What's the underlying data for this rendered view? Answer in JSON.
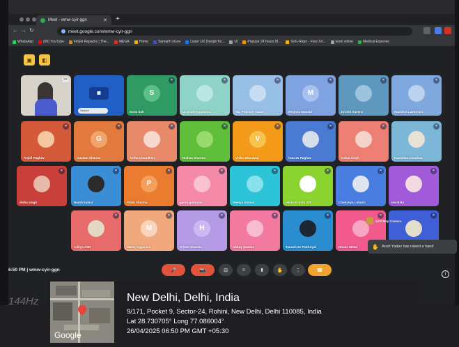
{
  "browser": {
    "tab_title": "Meet - wmw-cyir-ggn",
    "url": "meet.google.com/wmw-cyir-ggn",
    "bookmarks": [
      "WhatsApp",
      "(89) YouTube",
      "FitGirl Repacks | The...",
      "MEGA",
      "Home",
      "Samarth eGov",
      "Learn UX Design for...",
      "UI",
      "Popular 24 hours M...",
      "SVG Repo - Free SV...",
      "work online",
      "Medical Expense"
    ]
  },
  "meet": {
    "meeting_info": "6:50 PM  |  wmw-cyir-ggn",
    "raised_hand_toast": "Ansh Yadav has raised a hand",
    "self_tile_search": "Search",
    "participants": [
      {
        "name": "",
        "initial": "",
        "color": "#d7d3cb",
        "avatar_color": "#3a3534"
      },
      {
        "name": "",
        "initial": "",
        "color": "#1f5fc6",
        "avatar_color": "#1f5fc6"
      },
      {
        "name": "Sonu Sah",
        "initial": "S",
        "color": "#2f9a63",
        "avatar_color": "#5cbf8a"
      },
      {
        "name": "Dr.Southeggulattar...",
        "initial": "",
        "color": "#8fd3c8",
        "avatar_color": "#b9e6e0"
      },
      {
        "name": "Ms. Poonam Yadav",
        "initial": "",
        "color": "#98bfe6",
        "avatar_color": "#c8dcf2"
      },
      {
        "name": "Meghna Mandal",
        "initial": "M",
        "color": "#7fa3e0",
        "avatar_color": "#a9c1ee"
      },
      {
        "name": "Drishti Saxena",
        "initial": "",
        "color": "#5f98bf",
        "avatar_color": "#9dc3dd"
      },
      {
        "name": "Nachiket Lakhmani",
        "initial": "",
        "color": "#7fa8de",
        "avatar_color": "#bcd2ef"
      },
      {
        "name": "Anjali Raghav",
        "initial": "",
        "color": "#d55a3a",
        "avatar_color": "#f4c7a1"
      },
      {
        "name": "Gautam Sharma",
        "initial": "G",
        "color": "#e27a3e",
        "avatar_color": "#f1a46e"
      },
      {
        "name": "Astha Choudhary",
        "initial": "",
        "color": "#e88a6a",
        "avatar_color": "#f7d8cf"
      },
      {
        "name": "Bishan Sharma",
        "initial": "",
        "color": "#5fbf3a",
        "avatar_color": "#9ad96e"
      },
      {
        "name": "Vishu Bhardwaj",
        "initial": "V",
        "color": "#f39a1a",
        "avatar_color": "#f7c24e"
      },
      {
        "name": "Gaurav Raghav",
        "initial": "",
        "color": "#4a7ad2",
        "avatar_color": "#d7dee9"
      },
      {
        "name": "Rahul singh",
        "initial": "",
        "color": "#ee7f74",
        "avatar_color": "#f4d3cc"
      },
      {
        "name": "Kanishka Chauhan",
        "initial": "",
        "color": "#7cb7d8",
        "avatar_color": "#e9e2d7"
      },
      {
        "name": "disha singh",
        "initial": "",
        "color": "#c9403a",
        "avatar_color": "#e7b9a8"
      },
      {
        "name": "Harsh kumar",
        "initial": "",
        "color": "#3a8ed6",
        "avatar_color": "#2b2b2b"
      },
      {
        "name": "Palak Sharma",
        "initial": "P",
        "color": "#ea7b2f",
        "avatar_color": "#f3a05d"
      },
      {
        "name": "garvit goswami",
        "initial": "",
        "color": "#f48aa8",
        "avatar_color": "#fac1d2"
      },
      {
        "name": "Geetya Anand",
        "initial": "",
        "color": "#2dc4d8",
        "avatar_color": "#88e2ec"
      },
      {
        "name": "Ishika Kundu 338",
        "initial": "",
        "color": "#8bd32f",
        "avatar_color": "#ffffff"
      },
      {
        "name": "Chaitanya Luhach",
        "initial": "",
        "color": "#4a7de0",
        "avatar_color": "#dfe5ef"
      },
      {
        "name": "Harshita",
        "initial": "",
        "color": "#a15ad8",
        "avatar_color": "#f2dbe0"
      },
      {
        "name": "Aditya ASR",
        "initial": "",
        "color": "#e86b6b",
        "avatar_color": "#e2d8c5"
      },
      {
        "name": "Mansi Aggarwal",
        "initial": "M",
        "color": "#f0a87c",
        "avatar_color": "#f7d4ba"
      },
      {
        "name": "Srishti Sharma",
        "initial": "H",
        "color": "#b59ae6",
        "avatar_color": "#cdb9f0"
      },
      {
        "name": "Abhay Saxena",
        "initial": "",
        "color": "#f27aa0",
        "avatar_color": "#f7bcd0"
      },
      {
        "name": "Tanushree Pokhriyal",
        "initial": "",
        "color": "#2a8dcf",
        "avatar_color": "#1f2633"
      },
      {
        "name": "Bhumi Mittal",
        "initial": "",
        "color": "#f25a8e",
        "avatar_color": "#f7a6c4"
      },
      {
        "name": "",
        "initial": "",
        "color": "#3f5fd6",
        "avatar_color": "#e4ddcb"
      }
    ]
  },
  "controls": [
    {
      "name": "mic-toggle",
      "color": "#e2533e"
    },
    {
      "name": "camera-toggle",
      "color": "#e2533e"
    },
    {
      "name": "captions",
      "color": "#3c4043"
    },
    {
      "name": "emoji",
      "color": "#3c4043"
    },
    {
      "name": "present",
      "color": "#3c4043"
    },
    {
      "name": "raise-hand",
      "color": "#3c4043"
    },
    {
      "name": "more-options",
      "color": "#3c4043"
    },
    {
      "name": "leave-call",
      "color": "#f0a32f"
    }
  ],
  "gps_overlay": {
    "app": "GPS Map Camera",
    "map_brand": "Google",
    "title": "New Delhi, Delhi, India",
    "address": "9/171, Pocket 9, Sector-24, Rohini, New Delhi, Delhi 110085, India",
    "latlong": "Lat 28.730705° Long 77.086004°",
    "datetime": "26/04/2025 06:50 PM GMT +05:30"
  },
  "monitor_brand": "144Hz"
}
